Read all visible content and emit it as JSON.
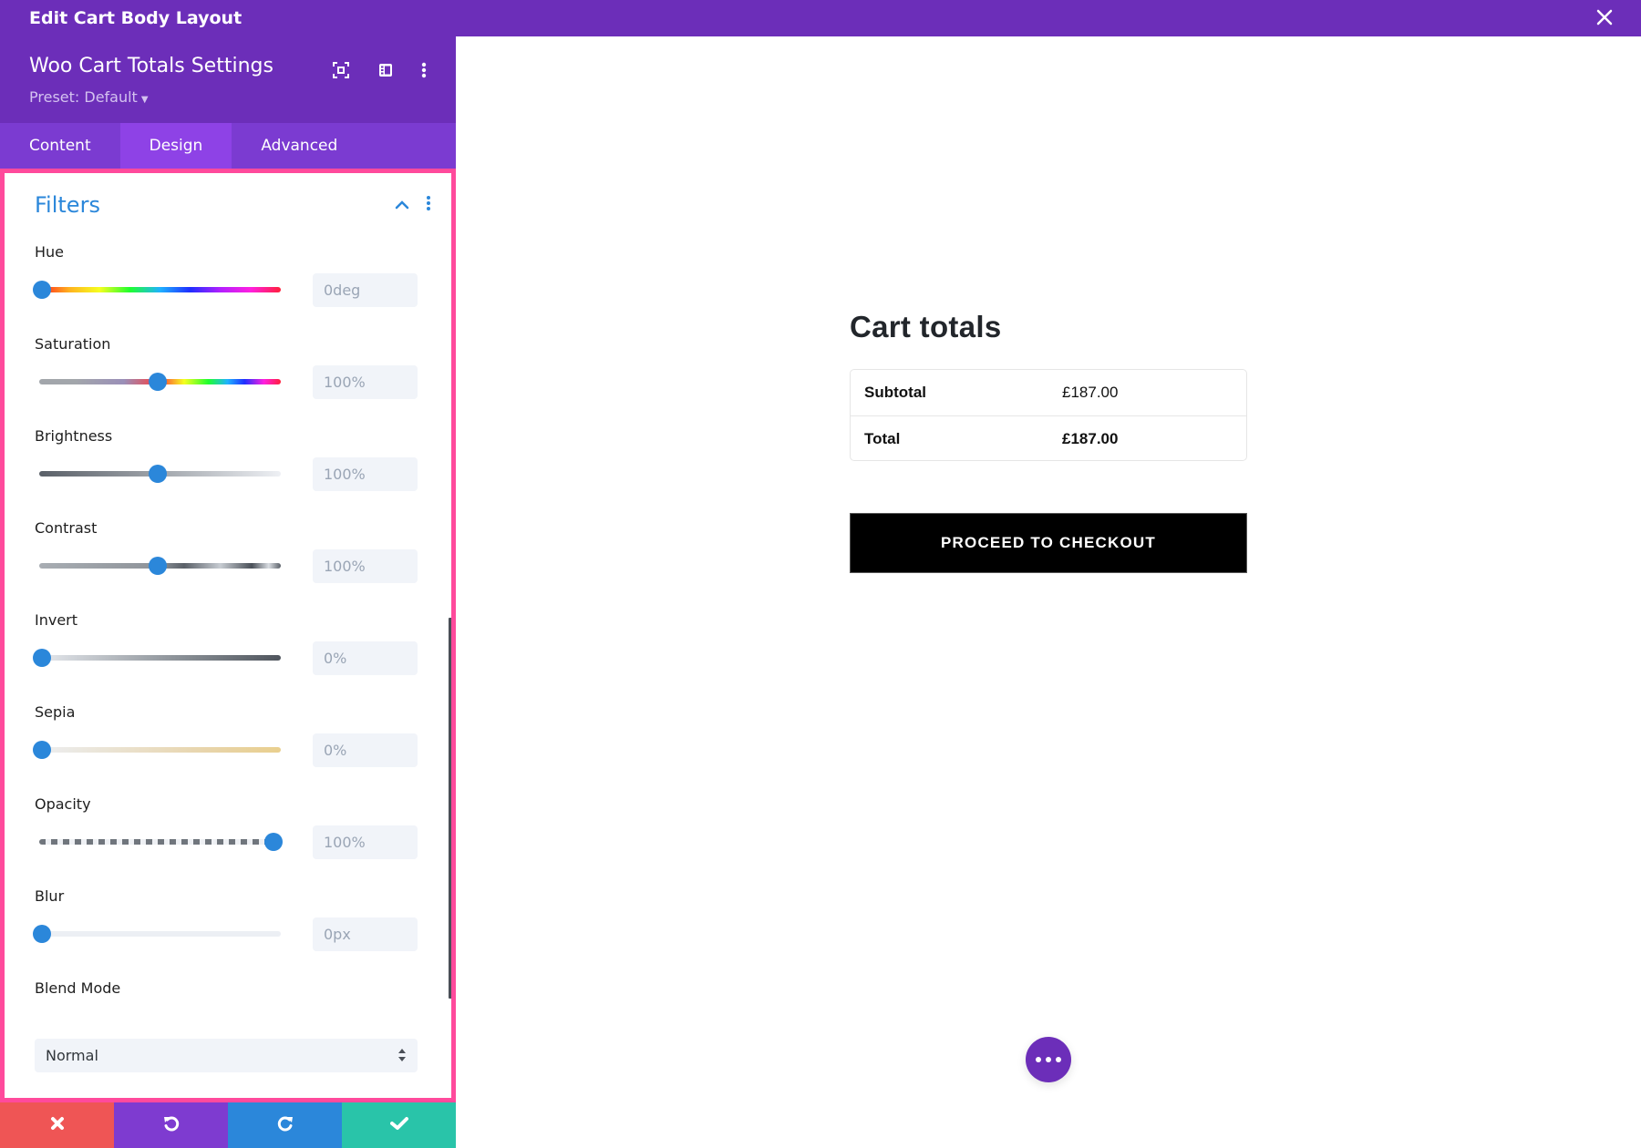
{
  "window": {
    "title": "Edit Cart Body Layout",
    "close_icon": "close-icon"
  },
  "panel": {
    "title": "Woo Cart Totals Settings",
    "preset_label": "Preset: Default",
    "header_icons": [
      "focus-mode-icon",
      "split-view-icon",
      "more-vertical-icon"
    ],
    "tabs": [
      {
        "label": "Content",
        "active": false
      },
      {
        "label": "Design",
        "active": true
      },
      {
        "label": "Advanced",
        "active": false
      }
    ],
    "section": {
      "title": "Filters",
      "expanded": true
    },
    "filters": [
      {
        "label": "Hue",
        "value": "0deg",
        "slider_fraction": 0.0
      },
      {
        "label": "Saturation",
        "value": "100%",
        "slider_fraction": 0.5
      },
      {
        "label": "Brightness",
        "value": "100%",
        "slider_fraction": 0.5
      },
      {
        "label": "Contrast",
        "value": "100%",
        "slider_fraction": 0.5
      },
      {
        "label": "Invert",
        "value": "0%",
        "slider_fraction": 0.0
      },
      {
        "label": "Sepia",
        "value": "0%",
        "slider_fraction": 0.0
      },
      {
        "label": "Opacity",
        "value": "100%",
        "slider_fraction": 1.0
      },
      {
        "label": "Blur",
        "value": "0px",
        "slider_fraction": 0.0
      }
    ],
    "blend_mode": {
      "label": "Blend Mode",
      "value": "Normal"
    },
    "footer": {
      "buttons": [
        {
          "name": "discard",
          "icon": "close-icon",
          "color": "#ef5555"
        },
        {
          "name": "undo",
          "icon": "undo-icon",
          "color": "#7e3bd0"
        },
        {
          "name": "redo",
          "icon": "redo-icon",
          "color": "#2b87da"
        },
        {
          "name": "save",
          "icon": "check-icon",
          "color": "#29c4a9"
        }
      ]
    }
  },
  "canvas": {
    "cart_title": "Cart totals",
    "rows": [
      {
        "label": "Subtotal",
        "value": "£187.00",
        "bold_value": false
      },
      {
        "label": "Total",
        "value": "£187.00",
        "bold_value": true
      }
    ],
    "checkout_label": "PROCEED TO CHECKOUT"
  },
  "colors": {
    "brand_purple": "#6c2eb9",
    "tab_bar": "#7b3bd1",
    "tab_active": "#8e42e6",
    "accent_blue": "#2b87da",
    "highlight_pink": "#ff4a9c"
  }
}
